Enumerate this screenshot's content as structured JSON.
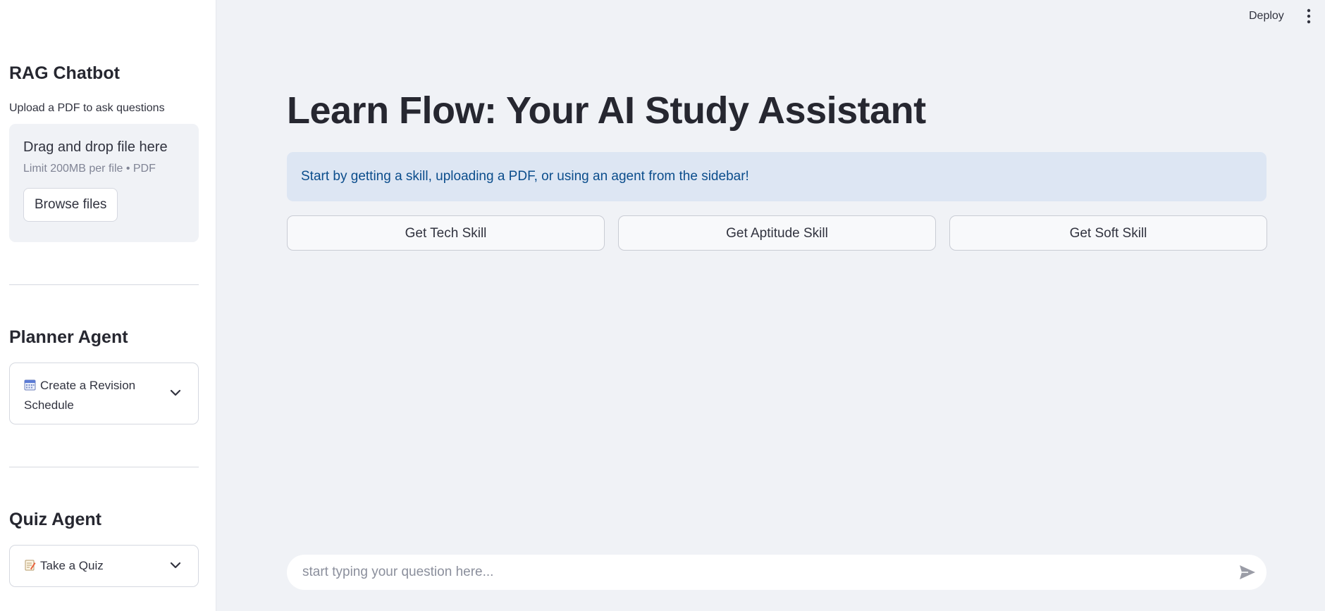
{
  "header": {
    "deploy_label": "Deploy",
    "menu_icon": "kebab-menu-icon"
  },
  "sidebar": {
    "rag": {
      "title": "RAG Chatbot",
      "caption": "Upload a PDF to ask questions",
      "uploader": {
        "drag_text": "Drag and drop file here",
        "limit_text": "Limit 200MB per file • PDF",
        "browse_label": "Browse files"
      }
    },
    "planner": {
      "title": "Planner Agent",
      "expander_label": "Create a Revision Schedule",
      "expander_icon": "calendar-icon"
    },
    "quiz": {
      "title": "Quiz Agent",
      "expander_label": "Take a Quiz",
      "expander_icon": "memo-icon"
    }
  },
  "main": {
    "title": "Learn Flow: Your AI Study Assistant",
    "info": "Start by getting a skill, uploading a PDF, or using an agent from the sidebar!",
    "buttons": [
      {
        "label": "Get Tech Skill"
      },
      {
        "label": "Get Aptitude Skill"
      },
      {
        "label": "Get Soft Skill"
      }
    ],
    "chat": {
      "placeholder": "start typing your question here...",
      "send_icon": "send-icon"
    }
  },
  "colors": {
    "background": "#f0f2f6",
    "sidebar": "#ffffff",
    "info_bg": "#dde6f3",
    "info_text": "#0b4d8c"
  }
}
